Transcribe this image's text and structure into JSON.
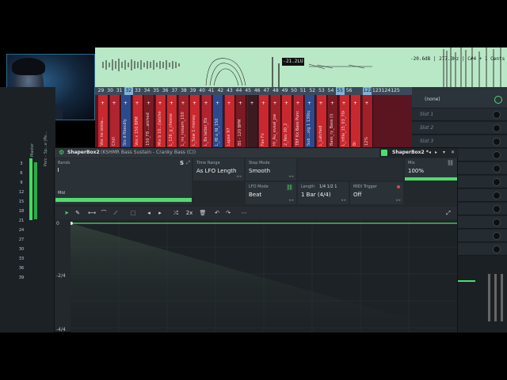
{
  "spectrum": {
    "peak_readout": "-21.2LU",
    "info_readout": "-20.6dB | 277.3Hz | C#4 + 1 Cents"
  },
  "mixer": {
    "track_numbers": [
      "3",
      "6",
      "9",
      "12",
      "15",
      "18",
      "21",
      "24",
      "27",
      "30",
      "33",
      "36",
      "39"
    ],
    "vertical_label_1": "Master",
    "vertical_label_2": "Perc - Sp...e (Pe..."
  },
  "playlist": {
    "numbers": [
      "29",
      "30",
      "31",
      "32",
      "33",
      "34",
      "35",
      "36",
      "37",
      "38",
      "39",
      "40",
      "41",
      "42",
      "43",
      "44",
      "45",
      "46",
      "47",
      "48",
      "49",
      "50",
      "51",
      "52",
      "53",
      "54",
      "55",
      "56",
      "",
      "122",
      "123",
      "124",
      "125"
    ],
    "clip_labels": [
      "Vox ne sosta...",
      "Chill",
      "Sts d ftkecdly",
      "Vos x 150 BPM",
      "150_F8 ...atched",
      "Mix b 10...(latched)",
      "L_126_g_cheese",
      "L_nv_nxsam_150",
      "L_5ew 1 money",
      "L_Bs latter_Eb",
      "L_f8 u_fd_150",
      "Lapse 97",
      "BS - 120 BPM",
      "",
      "Fav Fx",
      "Hi_Au_eveal_pw",
      "2_Rev 30_2",
      "TBF Kx Bass Punch",
      "Sub ...xig 1 130bpm",
      "L_Latched",
      "Bass_ry_Bass (l)",
      "L_hfile_15_03_70k",
      "Br",
      "12%"
    ]
  },
  "right_panel": {
    "none_label": "(none)",
    "slots": [
      "Slot 1",
      "Slot 2",
      "Slot 3"
    ]
  },
  "shaperbox": {
    "title": "ShaperBox2",
    "preset": "(KSHMR Bass Sustain - Cranky Bass (C))",
    "tab_title": "ShaperBox2 *",
    "bands": {
      "label": "Bands",
      "s_button": "S",
      "mid_label": "Mid"
    },
    "time_range": {
      "label": "Time Range",
      "value": "As LFO Length"
    },
    "step_mode": {
      "label": "Step Mode",
      "value": "Smooth"
    },
    "lfo_mode": {
      "label": "LFO Mode",
      "value": "Beat"
    },
    "length": {
      "label": "Length",
      "options": "1/4  1/2  1",
      "value": "1 Bar (4/4)"
    },
    "midi_trigger": {
      "label": "MIDI Trigger",
      "value": "Off"
    },
    "mix": {
      "label": "Mix",
      "value": "100%"
    },
    "toolbar": {
      "zoom_label": "2x"
    },
    "graph": {
      "y_labels": [
        "0",
        "-2/4",
        "-4/4"
      ]
    }
  },
  "colors": {
    "accent_green": "#4fdc6f",
    "clip_red": "#c8282e",
    "spectrum_bg": "#b9e8c6"
  }
}
